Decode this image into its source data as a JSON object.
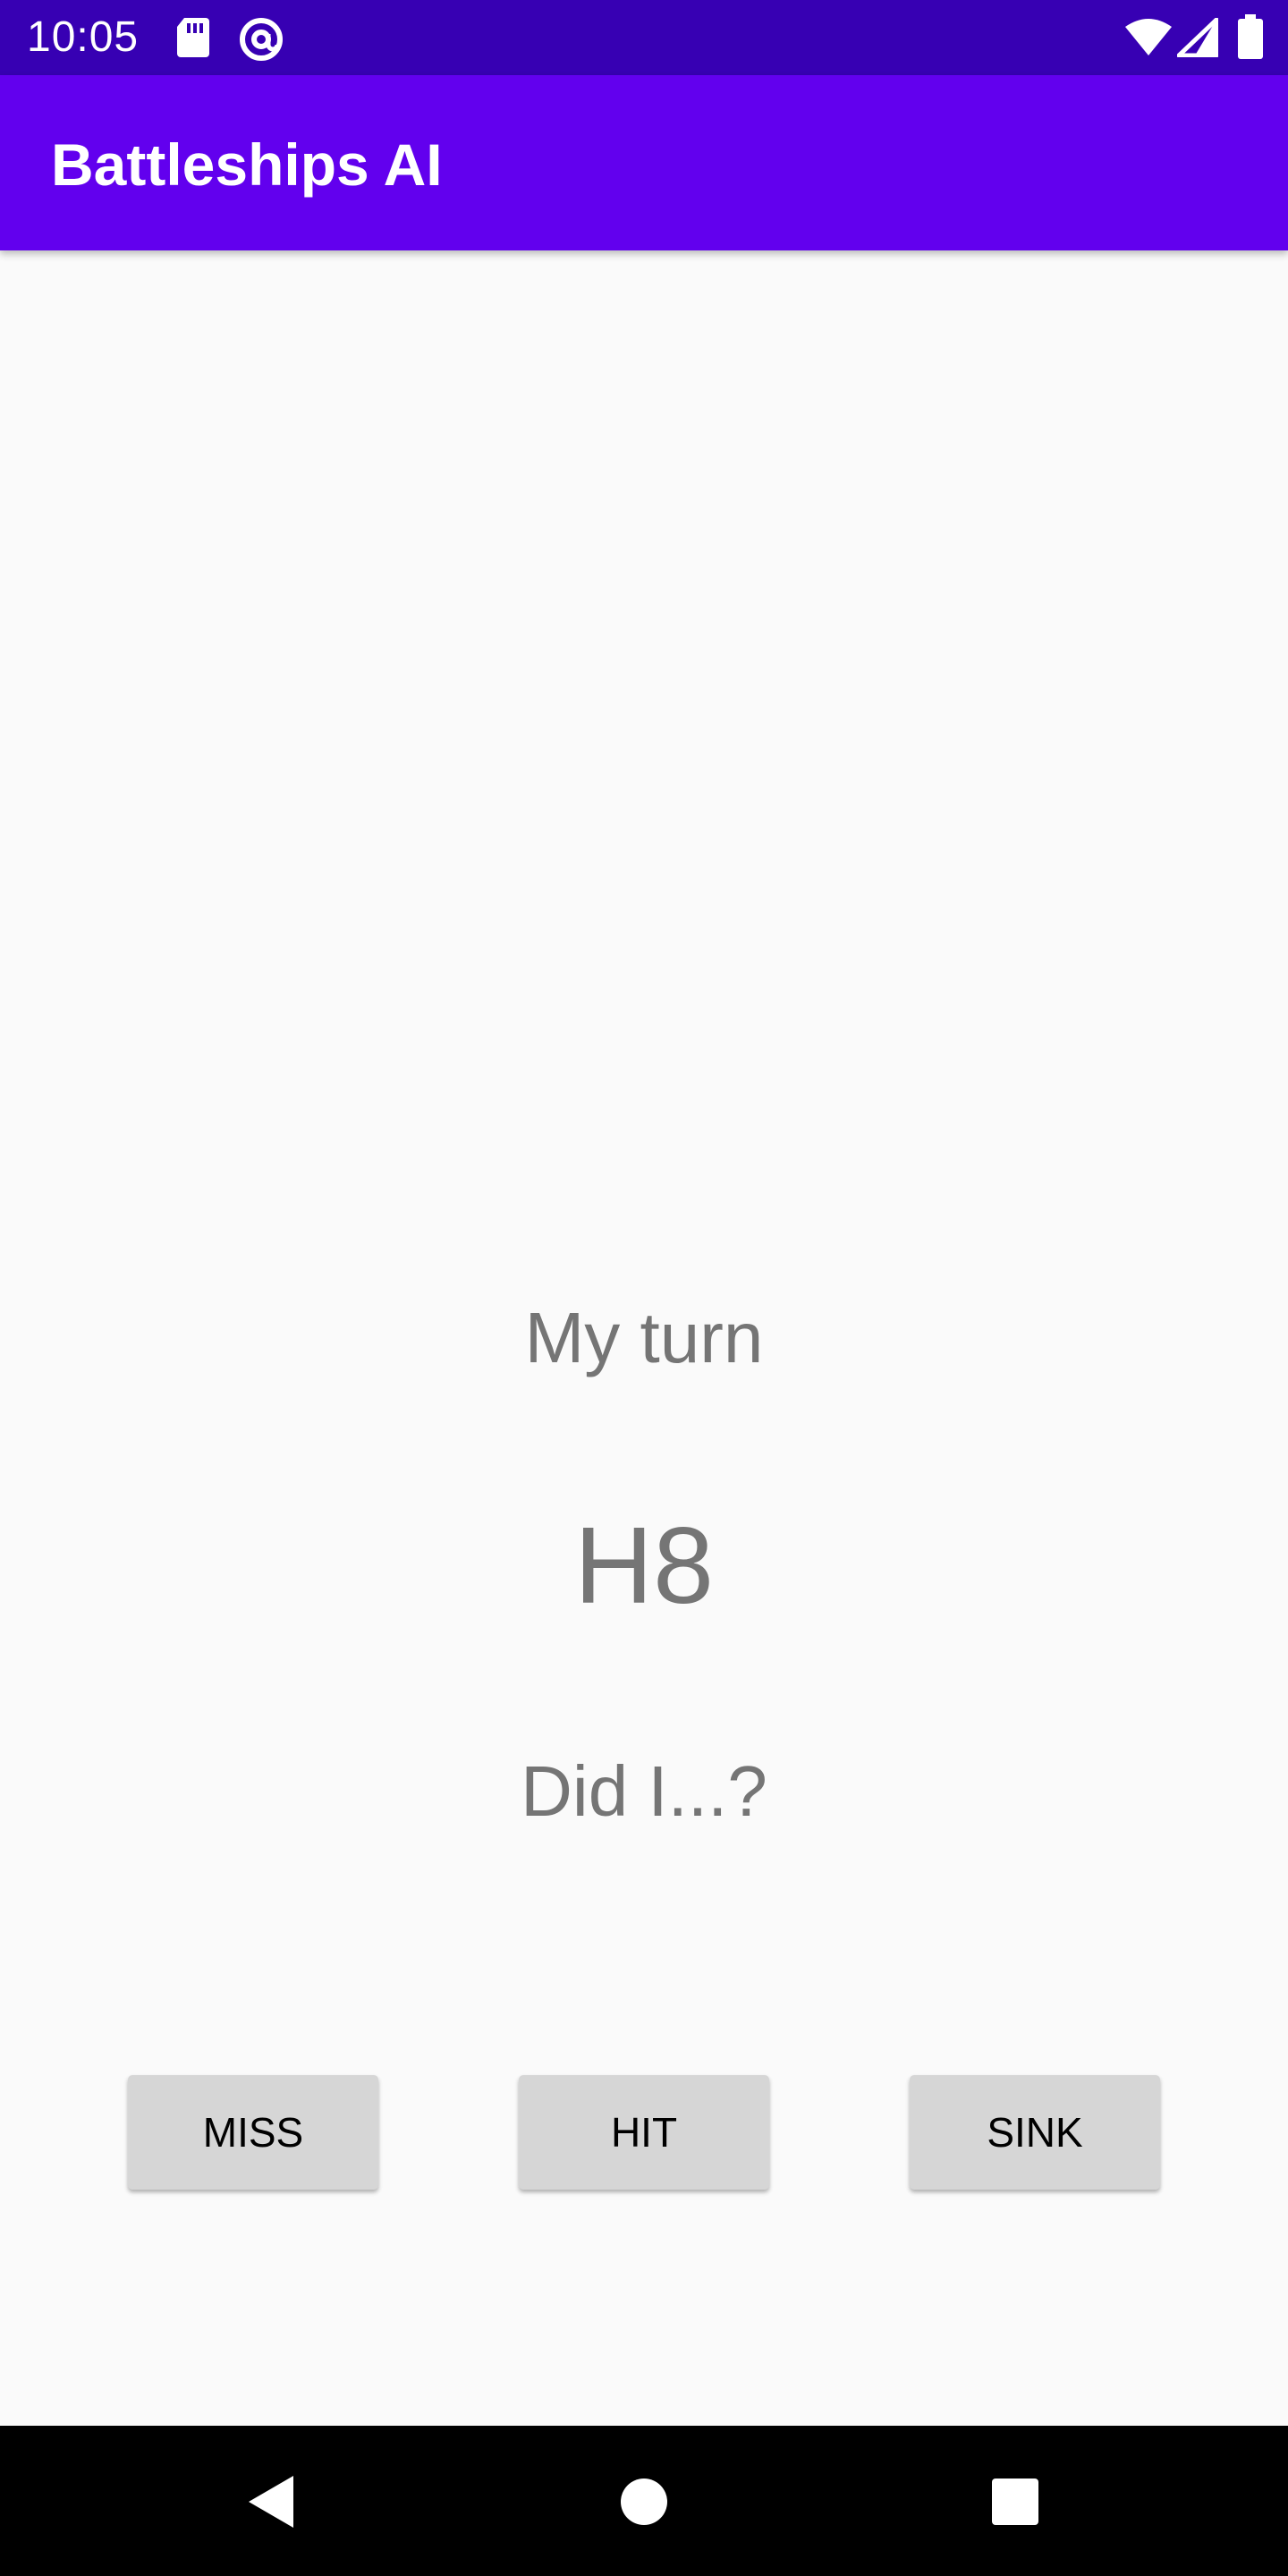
{
  "status_bar": {
    "time": "10:05",
    "icons": [
      "sd-card-icon",
      "at-sign-icon",
      "wifi-icon",
      "signal-icon",
      "battery-icon"
    ]
  },
  "app_bar": {
    "title": "Battleships AI"
  },
  "game": {
    "turn_label": "My turn",
    "coordinate": "H8",
    "question": "Did I...?"
  },
  "buttons": {
    "miss": "MISS",
    "hit": "HIT",
    "sink": "SINK"
  },
  "nav_bar": {
    "icons": [
      "back-icon",
      "home-icon",
      "recents-icon"
    ]
  },
  "colors": {
    "status_bar": "#3700b3",
    "app_bar": "#6200ee",
    "background": "#fafafa",
    "text_secondary": "#757575",
    "button": "#d6d6d6",
    "nav_bar": "#000000"
  }
}
